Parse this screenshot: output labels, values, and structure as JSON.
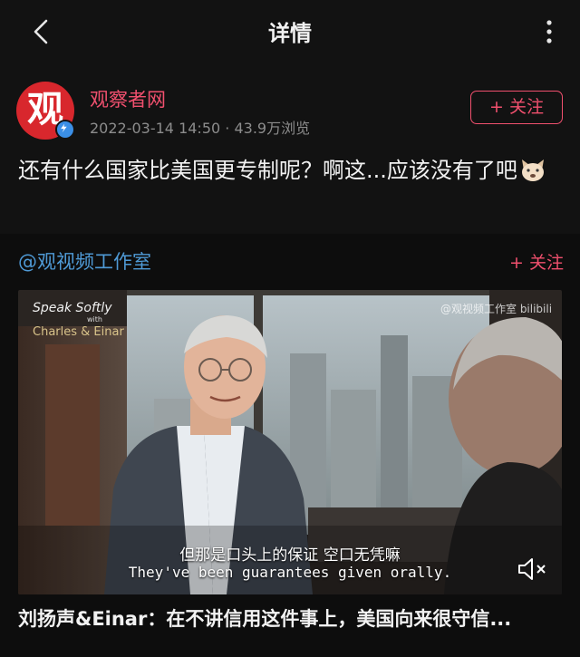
{
  "header": {
    "title": "详情",
    "back_icon": "chevron-left-icon",
    "more_icon": "vertical-dots-icon"
  },
  "post": {
    "avatar_text": "观",
    "author": "观察者网",
    "date": "2022-03-14 14:50",
    "separator": "·",
    "views": "43.9万浏览",
    "follow_label": "+ 关注",
    "text": "还有什么国家比美国更专制呢？啊这...应该没有了吧",
    "emoji": "dog-face-icon"
  },
  "video_card": {
    "channel": "@观视频工作室",
    "follow_label": "+ 关注",
    "brand_line1": "Speak Softly",
    "brand_with": "with",
    "brand_line2": "Charles & Einar",
    "watermark": "@观视频工作室 bilibili",
    "subtitle_zh": "但那是口头上的保证 空口无凭嘛",
    "subtitle_en": "They've been guarantees given orally.",
    "mute_icon": "volume-mute-icon",
    "caption": "刘扬声&Einar：在不讲信用这件事上，美国向来很守信..."
  },
  "colors": {
    "accent": "#f0506e",
    "link": "#4f9ad6",
    "avatar_bg": "#d8272d"
  }
}
